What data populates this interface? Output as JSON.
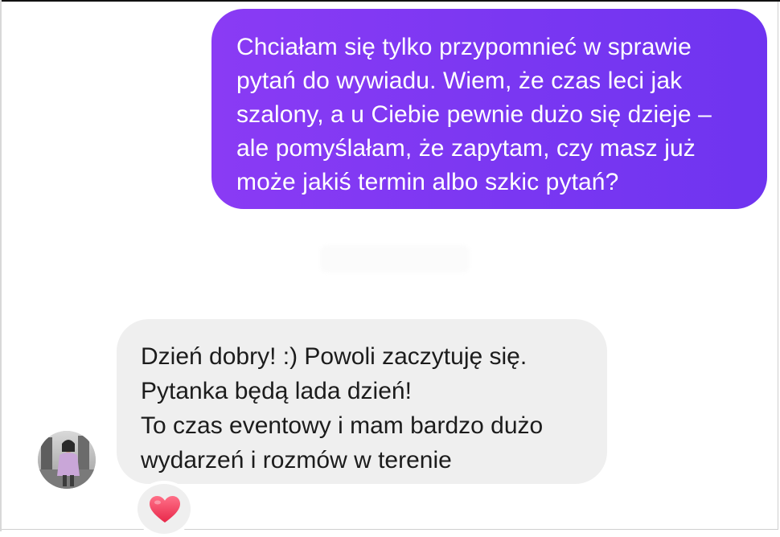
{
  "outgoing_message": {
    "lines": [
      "Chciałam się tylko przypomnieć w sprawie",
      "pytań do wywiadu. Wiem, że czas leci jak",
      "szalony, a u Ciebie pewnie dużo się dzieje –",
      "ale pomyślałam, że zapytam, czy masz już",
      "może jakiś termin albo szkic pytań?"
    ],
    "bubble_color": "#7a37f2",
    "text_color": "#ffffff"
  },
  "incoming_message": {
    "lines": [
      "Dzień dobry! :) Powoli zaczytuję się.",
      "Pytanka będą lada dzień!",
      "To czas eventowy i mam bardzo dużo",
      "wydarzeń i rozmów w terenie"
    ],
    "bubble_color": "#efefef",
    "text_color": "#1c1c1c"
  },
  "sender_avatar": {
    "icon": "avatar-photo"
  },
  "reaction": {
    "icon": "heart-icon",
    "color": "#f0435e"
  }
}
